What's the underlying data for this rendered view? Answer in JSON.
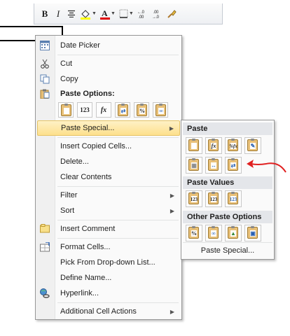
{
  "toolbar": {
    "bold": "B",
    "italic": "I",
    "inc_decimal": "+.0\n.00",
    "dec_decimal": ".00\n+.0",
    "buttons": [
      "bold",
      "italic",
      "center-align",
      "fill-color",
      "font-color",
      "borders",
      "increase-decimal",
      "decrease-decimal",
      "format-painter"
    ]
  },
  "menu": {
    "items": [
      {
        "label": "Date Picker",
        "icon": "calendar-icon"
      },
      {
        "label": "Cut",
        "icon": "scissors-icon"
      },
      {
        "label": "Copy",
        "icon": "copy-icon"
      },
      {
        "label": "Paste Options:",
        "icon": "clipboard-icon"
      },
      {
        "label": "Paste Special...",
        "submenu": true
      },
      {
        "label": "Insert Copied Cells..."
      },
      {
        "label": "Delete..."
      },
      {
        "label": "Clear Contents"
      },
      {
        "label": "Filter",
        "submenu": true
      },
      {
        "label": "Sort",
        "submenu": true
      },
      {
        "label": "Insert Comment",
        "icon": "comment-icon"
      },
      {
        "label": "Format Cells...",
        "icon": "format-cells-icon"
      },
      {
        "label": "Pick From Drop-down List..."
      },
      {
        "label": "Define Name..."
      },
      {
        "label": "Hyperlink...",
        "icon": "hyperlink-icon"
      },
      {
        "label": "Additional Cell Actions",
        "submenu": true
      }
    ],
    "paste_options": [
      "paste",
      "values",
      "formulas",
      "transpose",
      "formatting",
      "paste-link"
    ],
    "paste_option_labels": {
      "values": "123",
      "formulas": "fx",
      "formatting": "%"
    }
  },
  "submenu": {
    "paste_header": "Paste",
    "paste_values_header": "Paste Values",
    "other_header": "Other Paste Options",
    "footer": "Paste Special...",
    "paste_row1": [
      "paste",
      "formulas",
      "formulas-number-formatting",
      "keep-source-formatting"
    ],
    "paste_row2": [
      "no-borders",
      "keep-column-widths",
      "transpose"
    ],
    "values_row": [
      "values",
      "values-number-formatting",
      "values-source-formatting"
    ],
    "other_row": [
      "formatting",
      "paste-link",
      "picture",
      "linked-picture"
    ],
    "labels": {
      "formulas": "fx",
      "formulas_pct": "%fx",
      "values": "123",
      "values_pct": "123",
      "pct": "%"
    }
  },
  "colors": {
    "highlight": "#fde08c",
    "annotation_arrow": "#e02020"
  }
}
